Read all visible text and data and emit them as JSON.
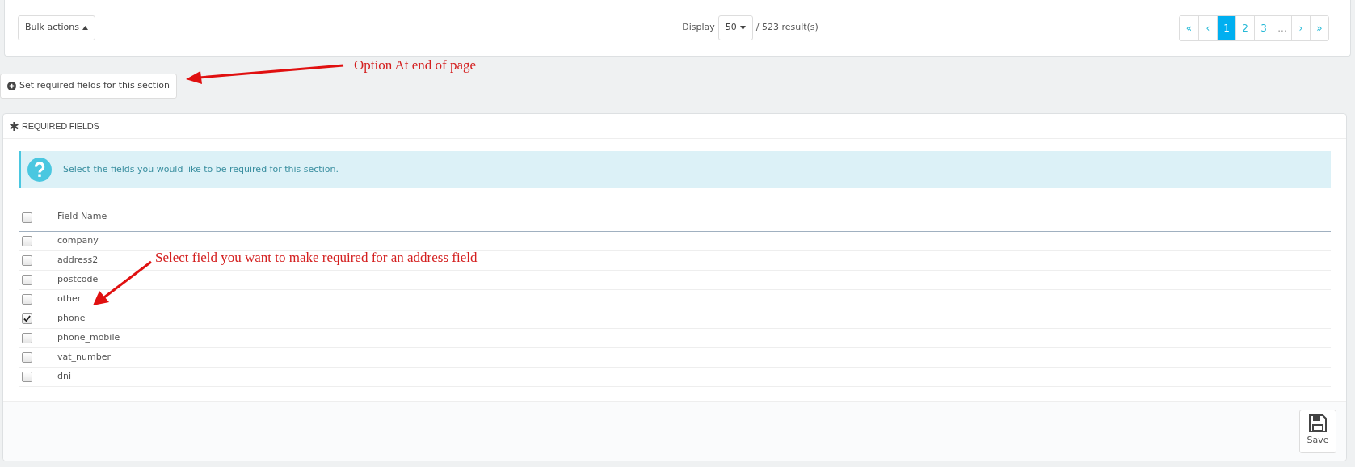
{
  "toolbar": {
    "bulk_actions": "Bulk actions",
    "display_label": "Display",
    "per_page": "50",
    "results": "/ 523 result(s)"
  },
  "pagination": [
    {
      "label": "«",
      "kind": "nav",
      "selected": false
    },
    {
      "label": "‹",
      "kind": "nav",
      "selected": false
    },
    {
      "label": "1",
      "kind": "page",
      "selected": true
    },
    {
      "label": "2",
      "kind": "page",
      "selected": false
    },
    {
      "label": "3",
      "kind": "page",
      "selected": false
    },
    {
      "label": "...",
      "kind": "gap",
      "selected": false
    },
    {
      "label": "›",
      "kind": "nav",
      "selected": false
    },
    {
      "label": "»",
      "kind": "nav",
      "selected": false
    }
  ],
  "set_required_button": "Set required fields for this section",
  "panel": {
    "title": "REQUIRED FIELDS",
    "info": "Select the fields you would like to be required for this section.",
    "column": "Field Name",
    "select_all_checked": false,
    "rows": [
      {
        "name": "company",
        "checked": false
      },
      {
        "name": "address2",
        "checked": false
      },
      {
        "name": "postcode",
        "checked": false
      },
      {
        "name": "other",
        "checked": false
      },
      {
        "name": "phone",
        "checked": true
      },
      {
        "name": "phone_mobile",
        "checked": false
      },
      {
        "name": "vat_number",
        "checked": false
      },
      {
        "name": "dni",
        "checked": false
      }
    ],
    "save": "Save"
  },
  "annotations": [
    "Option At end of page",
    "Select field you want to make required for an address field"
  ]
}
